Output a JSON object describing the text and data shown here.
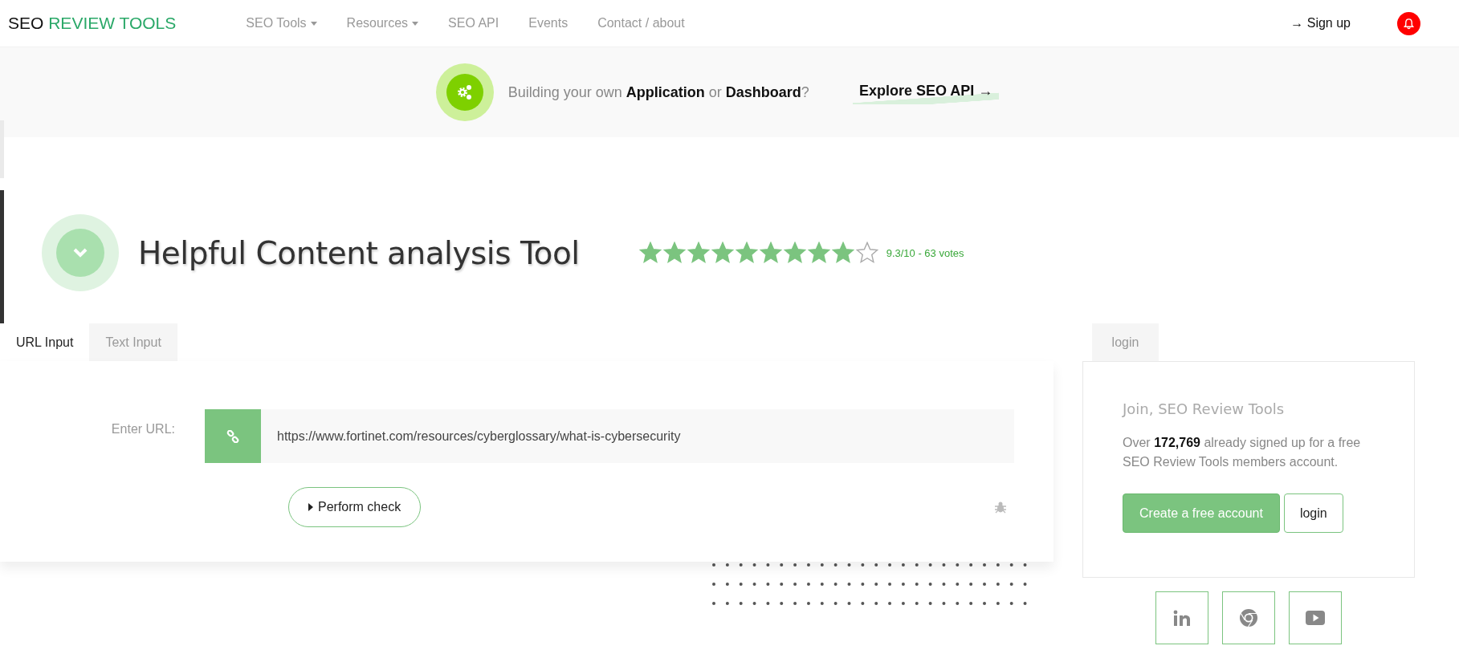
{
  "logo": {
    "prefix": "SEO",
    "accent": "REVIEW TOOLS"
  },
  "nav": [
    {
      "label": "SEO Tools",
      "has_menu": true
    },
    {
      "label": "Resources",
      "has_menu": true
    },
    {
      "label": "SEO API",
      "has_menu": false
    },
    {
      "label": "Events",
      "has_menu": false
    },
    {
      "label": "Contact / about",
      "has_menu": false
    }
  ],
  "signup": "→ Sign up",
  "banner": {
    "text": "Building your own **Application** or **Dashboard**?",
    "link": "Explore SEO API →"
  },
  "title": "Helpful Content analysis Tool",
  "rating": {
    "stars": 9,
    "text": "9.3/10 - 63 votes"
  },
  "tabs": [
    {
      "label": "URL Input",
      "selected": true
    },
    {
      "label": "Text Input",
      "selected": false
    }
  ],
  "url_label": "Enter URL:",
  "url_value": "https://www.fortinet.com/resources/cyberglossary/what-is-cybersecurity",
  "check_button": "Perform check",
  "side_tab": "login",
  "join": {
    "heading": "Join, SEO Review Tools",
    "text": "Over **172,769** already signed up for a free SEO Review Tools members account.",
    "create_button": "Create a free account",
    "login_button": "login"
  }
}
